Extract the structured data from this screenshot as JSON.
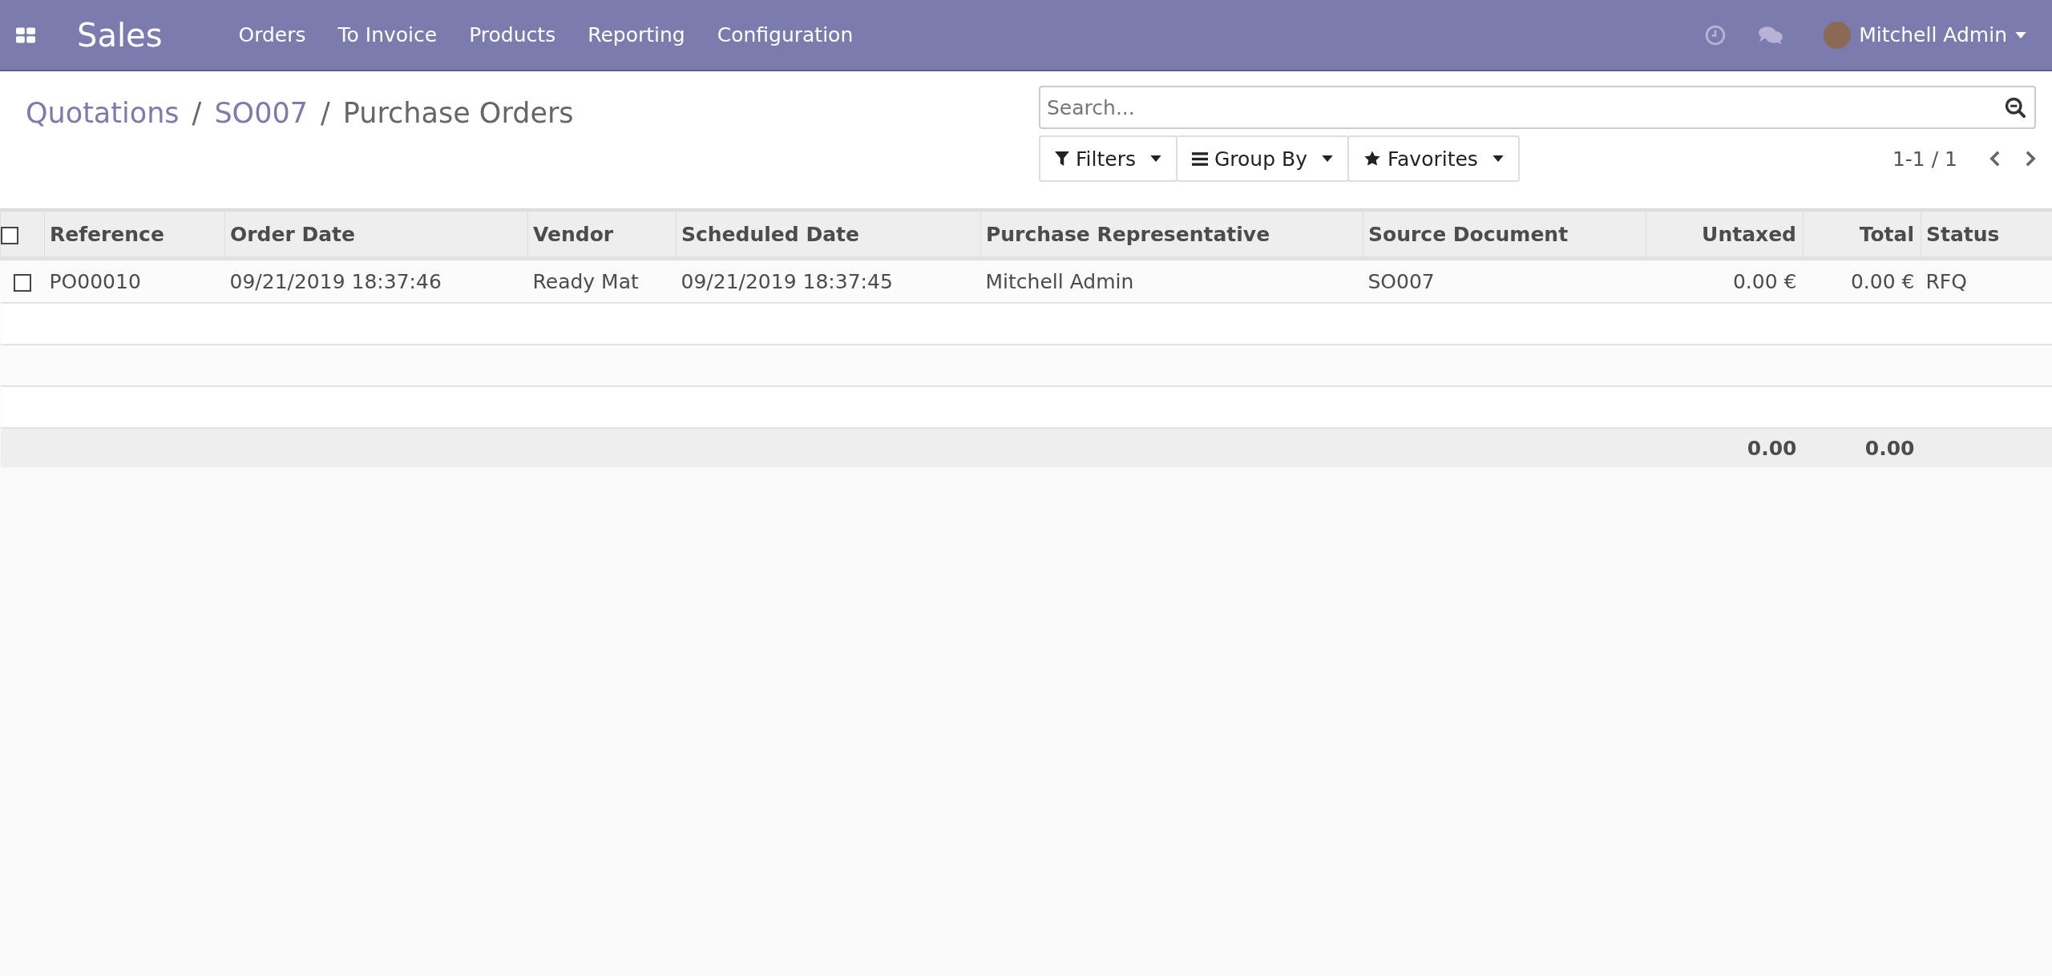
{
  "navbar": {
    "app_name": "Sales",
    "menu": [
      {
        "label": "Orders"
      },
      {
        "label": "To Invoice"
      },
      {
        "label": "Products"
      },
      {
        "label": "Reporting"
      },
      {
        "label": "Configuration"
      }
    ],
    "user": "Mitchell Admin"
  },
  "breadcrumb_separator": "/",
  "breadcrumb": [
    {
      "label": "Quotations",
      "kind": "link"
    },
    {
      "label": "SO007",
      "kind": "link"
    },
    {
      "label": "Purchase Orders",
      "kind": "current"
    }
  ],
  "search": {
    "placeholder": "Search..."
  },
  "search_options": [
    {
      "label": "Filters",
      "kind": "filter"
    },
    {
      "label": "Group By",
      "kind": "group"
    },
    {
      "label": "Favorites",
      "kind": "star"
    }
  ],
  "pager": {
    "value": "1-1 / 1"
  },
  "table": {
    "select_all": {
      "checked": false
    },
    "columns": [
      {
        "label": "Reference",
        "kind": "text"
      },
      {
        "label": "Order Date",
        "kind": "text"
      },
      {
        "label": "Vendor",
        "kind": "text"
      },
      {
        "label": "Scheduled Date",
        "kind": "text"
      },
      {
        "label": "Purchase Representative",
        "kind": "text"
      },
      {
        "label": "Source Document",
        "kind": "text"
      },
      {
        "label": "Untaxed",
        "kind": "numeric",
        "total": "0.00"
      },
      {
        "label": "Total",
        "kind": "numeric",
        "total": "0.00"
      },
      {
        "label": "Status",
        "kind": "text"
      }
    ],
    "rows": [
      {
        "checked": false,
        "cells": [
          "PO00010",
          "09/21/2019 18:37:46",
          "Ready Mat",
          "09/21/2019 18:37:45",
          "Mitchell Admin",
          "SO007",
          "0.00 €",
          "0.00 €",
          "RFQ"
        ]
      }
    ]
  }
}
